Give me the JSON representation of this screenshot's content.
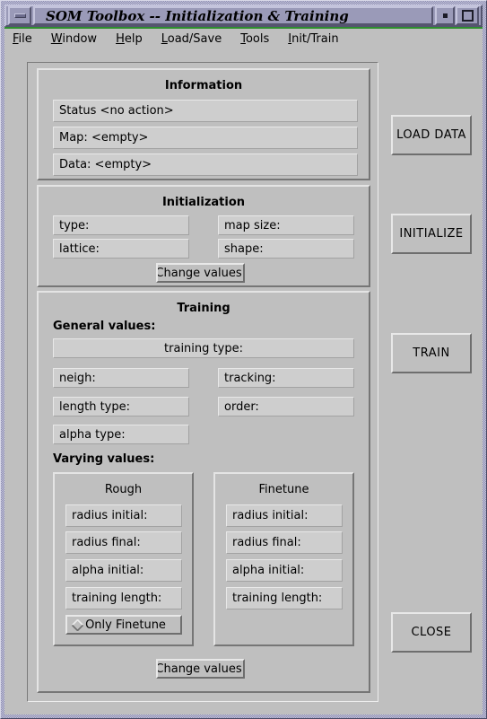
{
  "window": {
    "title": "SOM Toolbox -- Initialization & Training",
    "minimize_icon": "minimize-icon",
    "restore_icon": "restore-icon",
    "maximize_icon": "maximize-icon"
  },
  "menubar": {
    "items": [
      {
        "label": "File",
        "mnemonic": "F",
        "rest": "ile"
      },
      {
        "label": "Window",
        "mnemonic": "W",
        "rest": "indow"
      },
      {
        "label": "Help",
        "mnemonic": "H",
        "rest": "elp"
      },
      {
        "label": "Load/Save",
        "mnemonic": "L",
        "rest": "oad/Save"
      },
      {
        "label": "Tools",
        "mnemonic": "T",
        "rest": "ools"
      },
      {
        "label": "Init/Train",
        "mnemonic": "I",
        "rest": "nit/Train"
      }
    ]
  },
  "information": {
    "title": "Information",
    "fields": [
      {
        "label": "Status <no action>"
      },
      {
        "label": "Map: <empty>"
      },
      {
        "label": "Data: <empty>"
      }
    ]
  },
  "initialization": {
    "title": "Initialization",
    "fields": [
      {
        "label": "type:"
      },
      {
        "label": "map size:"
      },
      {
        "label": "lattice:"
      },
      {
        "label": "shape:"
      }
    ],
    "change_button": "Change values"
  },
  "training": {
    "title": "Training",
    "general_label": "General values:",
    "varying_label": "Varying values:",
    "training_type": "training type:",
    "general_fields": [
      {
        "label": "neigh:"
      },
      {
        "label": "tracking:"
      },
      {
        "label": "length type:"
      },
      {
        "label": "order:"
      },
      {
        "label": "alpha type:"
      }
    ],
    "rough": {
      "title": "Rough",
      "fields": [
        {
          "label": "radius initial:"
        },
        {
          "label": "radius final:"
        },
        {
          "label": "alpha initial:"
        },
        {
          "label": "training length:"
        }
      ],
      "only_finetune": "Only Finetune",
      "only_finetune_checked": false
    },
    "finetune": {
      "title": "Finetune",
      "fields": [
        {
          "label": "radius initial:"
        },
        {
          "label": "radius final:"
        },
        {
          "label": "alpha initial:"
        },
        {
          "label": "training length:"
        }
      ]
    },
    "change_button": "Change values"
  },
  "actions": {
    "load_data": "LOAD DATA",
    "initialize": "INITIALIZE",
    "train": "TRAIN",
    "close": "CLOSE"
  },
  "colors": {
    "window_background": "#bfbfbf",
    "titlebar": "#9a9ab8",
    "field": "#cecece",
    "menubar_accent": "#2f8f2f",
    "frame": "#8a8ab0"
  }
}
